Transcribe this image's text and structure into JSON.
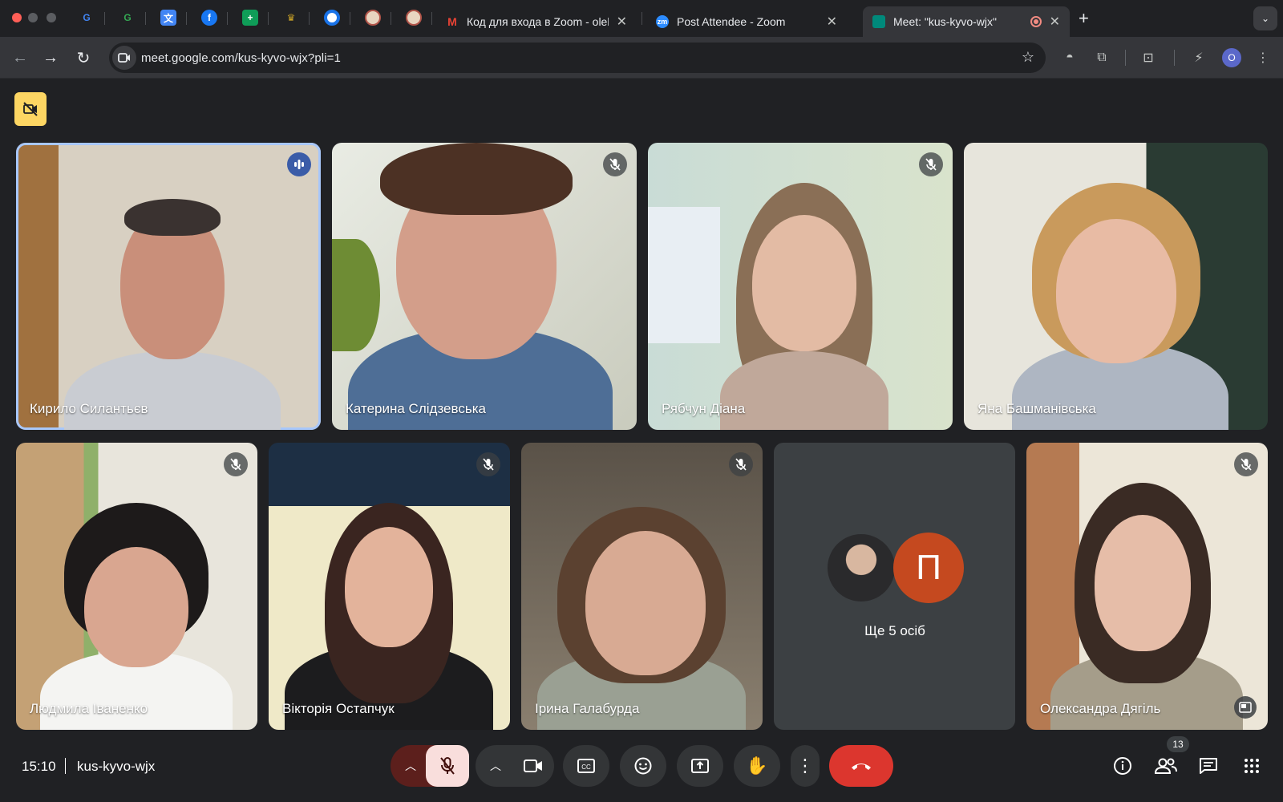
{
  "browser": {
    "tabs": [
      {
        "title": "Код для входа в Zoom - olek",
        "favicon": "gmail-icon"
      },
      {
        "title": "Post Attendee - Zoom",
        "favicon": "zoom-icon",
        "favicon_text": "zm"
      },
      {
        "title": "Meet: \"kus-kyvo-wjx\"",
        "favicon": "google-meet-icon",
        "recording": true
      }
    ],
    "url": "meet.google.com/kus-kyvo-wjx?pli=1",
    "profile_initial": "O"
  },
  "participants": [
    {
      "name": "Кирило Силантьєв",
      "speaking": true
    },
    {
      "name": "Катерина Слідзевська",
      "muted": true
    },
    {
      "name": "Рябчун Діана",
      "muted": true
    },
    {
      "name": "Яна Башманівська"
    },
    {
      "name": "Людмила Іваненко",
      "muted": true
    },
    {
      "name": "Вікторія Остапчук",
      "muted": true
    },
    {
      "name": "Ірина Галабурда",
      "muted": true
    },
    {
      "name": "Олександра Дягіль",
      "muted": true
    }
  ],
  "others": {
    "label": "Ще 5 осіб",
    "avatar_letter": "П"
  },
  "footer": {
    "time": "15:10",
    "meeting_code": "kus-kyvo-wjx",
    "people_count": "13"
  },
  "colors": {
    "speaking_outline": "#a8c7fa",
    "end_call": "#dc362e",
    "mic_off_bg": "#f9dedc"
  }
}
